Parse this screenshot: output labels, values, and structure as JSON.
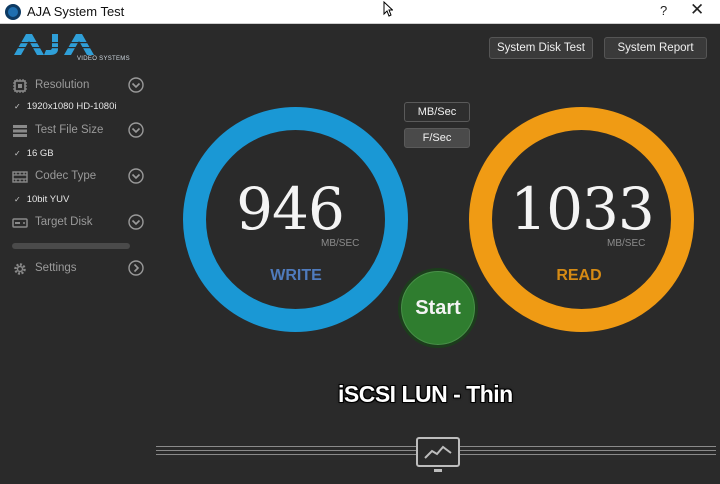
{
  "window": {
    "title": "AJA System Test",
    "help": "?",
    "close": "✕"
  },
  "logo": {
    "text": "AJA",
    "subtitle": "VIDEO SYSTEMS"
  },
  "sidebar": {
    "items": [
      {
        "label": "Resolution",
        "value": "1920x1080 HD-1080i",
        "icon": "resolution-icon"
      },
      {
        "label": "Test File Size",
        "value": "16 GB",
        "icon": "file-size-icon"
      },
      {
        "label": "Codec Type",
        "value": "10bit YUV",
        "icon": "codec-icon"
      },
      {
        "label": "Target Disk",
        "value": "",
        "icon": "disk-icon"
      },
      {
        "label": "Settings",
        "value": "",
        "icon": "gear-icon"
      }
    ]
  },
  "buttons": {
    "system_disk_test": "System Disk Test",
    "system_report": "System Report",
    "mb_sec": "MB/Sec",
    "f_sec": "F/Sec",
    "start": "Start"
  },
  "write": {
    "value": "946",
    "unit": "MB/SEC",
    "label": "WRITE",
    "color": "#1a98d5",
    "label_color": "#4f7bbd"
  },
  "read": {
    "value": "1033",
    "unit": "MB/SEC",
    "label": "READ",
    "color": "#f09b14",
    "label_color": "#d58a14"
  },
  "caption": "iSCSI LUN - Thin"
}
